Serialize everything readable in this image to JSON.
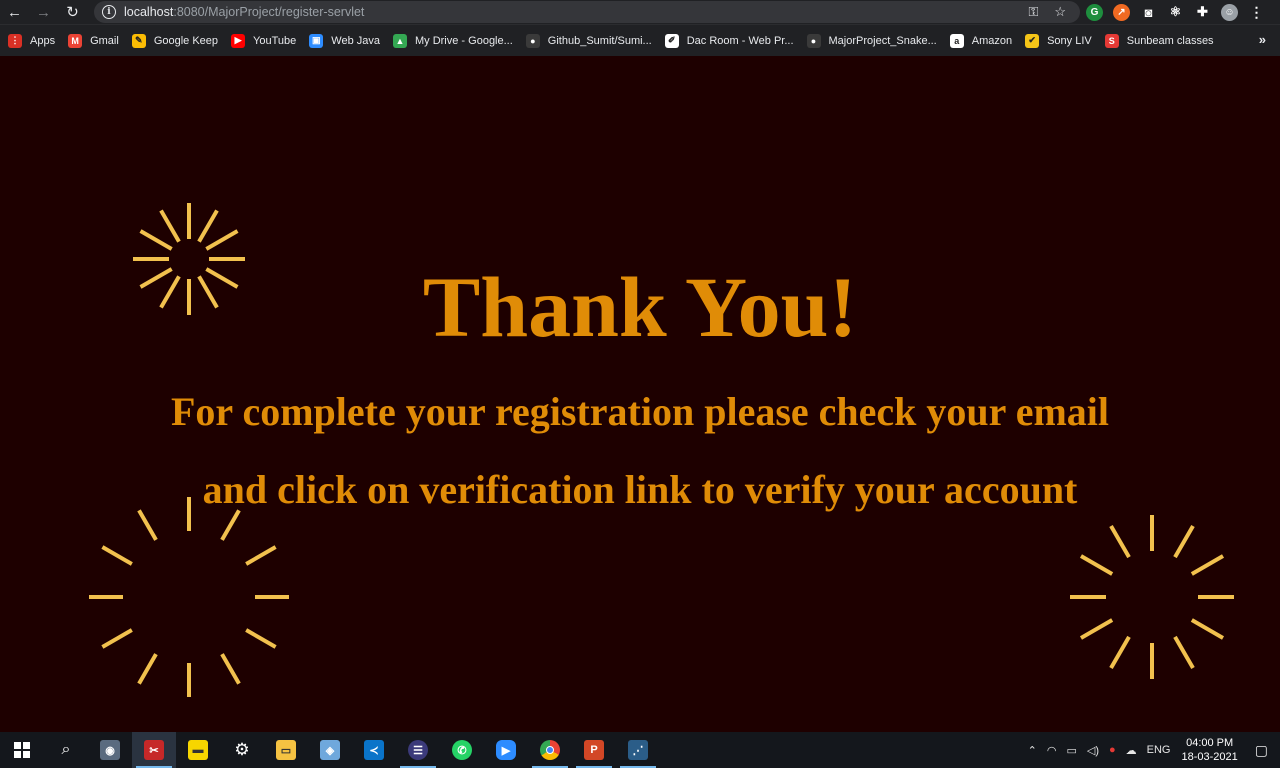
{
  "browser": {
    "url_host": "localhost",
    "url_rest": ":8080/MajorProject/register-servlet",
    "bookmarks": [
      {
        "label": "Apps",
        "color": "#d93025",
        "glyph": "⋮"
      },
      {
        "label": "Gmail",
        "color": "#ea4335",
        "glyph": "M"
      },
      {
        "label": "Google Keep",
        "color": "#fbbc04",
        "glyph": "✎"
      },
      {
        "label": "YouTube",
        "color": "#ff0000",
        "glyph": "▶"
      },
      {
        "label": "Web Java",
        "color": "#2d8cff",
        "glyph": "▣"
      },
      {
        "label": "My Drive - Google...",
        "color": "#34a853",
        "glyph": "▲"
      },
      {
        "label": "Github_Sumit/Sumi...",
        "color": "#3a3a3a",
        "glyph": "●"
      },
      {
        "label": "Dac Room - Web Pr...",
        "color": "#ffffff",
        "glyph": "✐"
      },
      {
        "label": "MajorProject_Snake...",
        "color": "#3a3a3a",
        "glyph": "●"
      },
      {
        "label": "Amazon",
        "color": "#ffffff",
        "glyph": "a"
      },
      {
        "label": "Sony LIV",
        "color": "#f5c518",
        "glyph": "✔"
      },
      {
        "label": "Sunbeam classes",
        "color": "#e53935",
        "glyph": "S"
      }
    ]
  },
  "page": {
    "heading": "Thank You!",
    "line1": "For complete your registration please check your email",
    "line2": "and click on verification link to verify your account"
  },
  "taskbar": {
    "lang": "ENG",
    "time": "04:00 PM",
    "date": "18-03-2021"
  },
  "colors": {
    "background": "#1e0000",
    "text": "#e08c07",
    "sparkle": "#f2c14e"
  }
}
